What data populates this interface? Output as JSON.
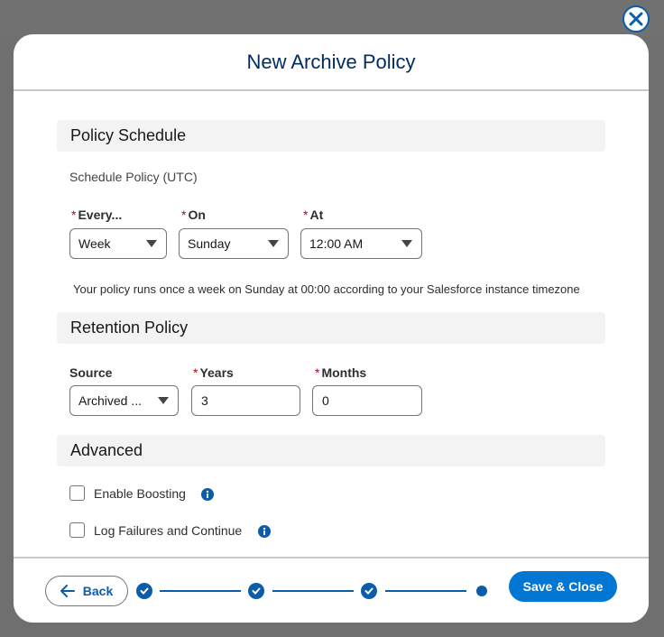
{
  "modal": {
    "title": "New Archive Policy"
  },
  "schedule": {
    "header": "Policy Schedule",
    "subtitle": "Schedule Policy (UTC)",
    "every": {
      "label": "Every...",
      "value": "Week"
    },
    "on": {
      "label": "On",
      "value": "Sunday"
    },
    "at": {
      "label": "At",
      "value": "12:00 AM"
    },
    "summary": "Your policy runs once a week on Sunday at 00:00 according to your Salesforce instance timezone"
  },
  "retention": {
    "header": "Retention Policy",
    "source": {
      "label": "Source",
      "value": "Archived ..."
    },
    "years": {
      "label": "Years",
      "value": "3"
    },
    "months": {
      "label": "Months",
      "value": "0"
    }
  },
  "advanced": {
    "header": "Advanced",
    "enable_boosting": {
      "label": "Enable Boosting",
      "checked": false
    },
    "log_failures": {
      "label": "Log Failures and Continue",
      "checked": false
    }
  },
  "footer": {
    "back_label": "Back",
    "save_label": "Save & Close",
    "steps": [
      "completed",
      "completed",
      "completed",
      "current"
    ]
  },
  "colors": {
    "brand": "#0176d3",
    "brand_dark": "#0b5cab",
    "title": "#032d60",
    "required": "#ba0517"
  },
  "icons": [
    "close-icon",
    "chevron-down-icon",
    "info-icon",
    "arrow-left-icon",
    "check-icon"
  ]
}
